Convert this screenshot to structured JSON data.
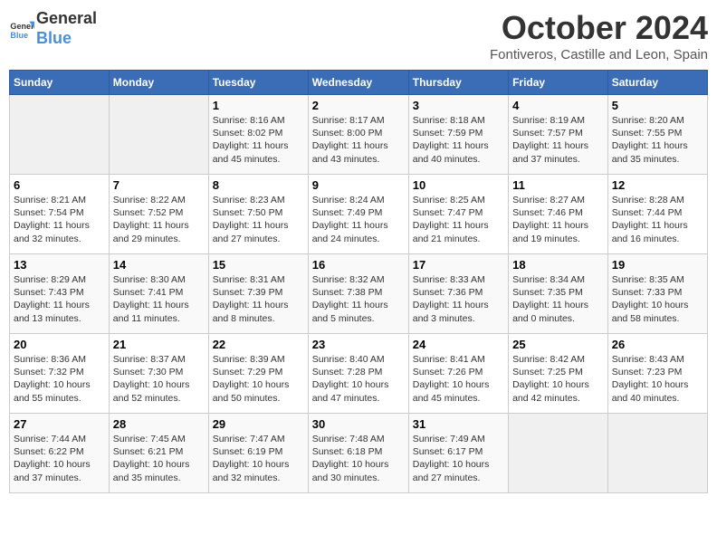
{
  "header": {
    "logo_general": "General",
    "logo_blue": "Blue",
    "month": "October 2024",
    "location": "Fontiveros, Castille and Leon, Spain"
  },
  "weekdays": [
    "Sunday",
    "Monday",
    "Tuesday",
    "Wednesday",
    "Thursday",
    "Friday",
    "Saturday"
  ],
  "weeks": [
    [
      {
        "day": "",
        "info": ""
      },
      {
        "day": "",
        "info": ""
      },
      {
        "day": "1",
        "info": "Sunrise: 8:16 AM\nSunset: 8:02 PM\nDaylight: 11 hours and 45 minutes."
      },
      {
        "day": "2",
        "info": "Sunrise: 8:17 AM\nSunset: 8:00 PM\nDaylight: 11 hours and 43 minutes."
      },
      {
        "day": "3",
        "info": "Sunrise: 8:18 AM\nSunset: 7:59 PM\nDaylight: 11 hours and 40 minutes."
      },
      {
        "day": "4",
        "info": "Sunrise: 8:19 AM\nSunset: 7:57 PM\nDaylight: 11 hours and 37 minutes."
      },
      {
        "day": "5",
        "info": "Sunrise: 8:20 AM\nSunset: 7:55 PM\nDaylight: 11 hours and 35 minutes."
      }
    ],
    [
      {
        "day": "6",
        "info": "Sunrise: 8:21 AM\nSunset: 7:54 PM\nDaylight: 11 hours and 32 minutes."
      },
      {
        "day": "7",
        "info": "Sunrise: 8:22 AM\nSunset: 7:52 PM\nDaylight: 11 hours and 29 minutes."
      },
      {
        "day": "8",
        "info": "Sunrise: 8:23 AM\nSunset: 7:50 PM\nDaylight: 11 hours and 27 minutes."
      },
      {
        "day": "9",
        "info": "Sunrise: 8:24 AM\nSunset: 7:49 PM\nDaylight: 11 hours and 24 minutes."
      },
      {
        "day": "10",
        "info": "Sunrise: 8:25 AM\nSunset: 7:47 PM\nDaylight: 11 hours and 21 minutes."
      },
      {
        "day": "11",
        "info": "Sunrise: 8:27 AM\nSunset: 7:46 PM\nDaylight: 11 hours and 19 minutes."
      },
      {
        "day": "12",
        "info": "Sunrise: 8:28 AM\nSunset: 7:44 PM\nDaylight: 11 hours and 16 minutes."
      }
    ],
    [
      {
        "day": "13",
        "info": "Sunrise: 8:29 AM\nSunset: 7:43 PM\nDaylight: 11 hours and 13 minutes."
      },
      {
        "day": "14",
        "info": "Sunrise: 8:30 AM\nSunset: 7:41 PM\nDaylight: 11 hours and 11 minutes."
      },
      {
        "day": "15",
        "info": "Sunrise: 8:31 AM\nSunset: 7:39 PM\nDaylight: 11 hours and 8 minutes."
      },
      {
        "day": "16",
        "info": "Sunrise: 8:32 AM\nSunset: 7:38 PM\nDaylight: 11 hours and 5 minutes."
      },
      {
        "day": "17",
        "info": "Sunrise: 8:33 AM\nSunset: 7:36 PM\nDaylight: 11 hours and 3 minutes."
      },
      {
        "day": "18",
        "info": "Sunrise: 8:34 AM\nSunset: 7:35 PM\nDaylight: 11 hours and 0 minutes."
      },
      {
        "day": "19",
        "info": "Sunrise: 8:35 AM\nSunset: 7:33 PM\nDaylight: 10 hours and 58 minutes."
      }
    ],
    [
      {
        "day": "20",
        "info": "Sunrise: 8:36 AM\nSunset: 7:32 PM\nDaylight: 10 hours and 55 minutes."
      },
      {
        "day": "21",
        "info": "Sunrise: 8:37 AM\nSunset: 7:30 PM\nDaylight: 10 hours and 52 minutes."
      },
      {
        "day": "22",
        "info": "Sunrise: 8:39 AM\nSunset: 7:29 PM\nDaylight: 10 hours and 50 minutes."
      },
      {
        "day": "23",
        "info": "Sunrise: 8:40 AM\nSunset: 7:28 PM\nDaylight: 10 hours and 47 minutes."
      },
      {
        "day": "24",
        "info": "Sunrise: 8:41 AM\nSunset: 7:26 PM\nDaylight: 10 hours and 45 minutes."
      },
      {
        "day": "25",
        "info": "Sunrise: 8:42 AM\nSunset: 7:25 PM\nDaylight: 10 hours and 42 minutes."
      },
      {
        "day": "26",
        "info": "Sunrise: 8:43 AM\nSunset: 7:23 PM\nDaylight: 10 hours and 40 minutes."
      }
    ],
    [
      {
        "day": "27",
        "info": "Sunrise: 7:44 AM\nSunset: 6:22 PM\nDaylight: 10 hours and 37 minutes."
      },
      {
        "day": "28",
        "info": "Sunrise: 7:45 AM\nSunset: 6:21 PM\nDaylight: 10 hours and 35 minutes."
      },
      {
        "day": "29",
        "info": "Sunrise: 7:47 AM\nSunset: 6:19 PM\nDaylight: 10 hours and 32 minutes."
      },
      {
        "day": "30",
        "info": "Sunrise: 7:48 AM\nSunset: 6:18 PM\nDaylight: 10 hours and 30 minutes."
      },
      {
        "day": "31",
        "info": "Sunrise: 7:49 AM\nSunset: 6:17 PM\nDaylight: 10 hours and 27 minutes."
      },
      {
        "day": "",
        "info": ""
      },
      {
        "day": "",
        "info": ""
      }
    ]
  ]
}
